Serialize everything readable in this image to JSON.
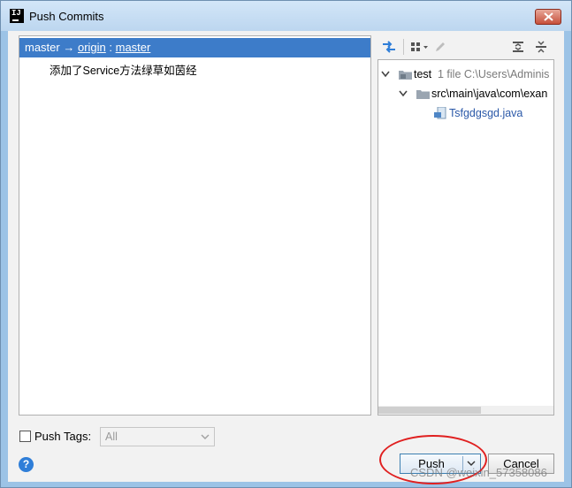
{
  "window": {
    "title": "Push Commits",
    "app_icon": "IJ"
  },
  "commits": {
    "branch_local": "master",
    "arrow": "→",
    "remote": "origin",
    "separator": " : ",
    "branch_remote": "master",
    "items": [
      "添加了Service方法绿草如茵经"
    ]
  },
  "files": {
    "toolbar_icons": [
      "compare-icon",
      "group-by-icon",
      "edit-icon",
      "expand-all-icon",
      "collapse-all-icon"
    ],
    "tree": {
      "root_label": "test",
      "root_meta": "1 file  C:\\Users\\Adminis",
      "dir_label": "src\\main\\java\\com\\exan",
      "file_label": "Tsfgdgsgd.java"
    }
  },
  "footer": {
    "push_tags_label": "Push Tags:",
    "tags_value": "All",
    "push_label": "Push",
    "cancel_label": "Cancel",
    "help": "?"
  },
  "watermark": "CSDN @weixin_57358086",
  "colors": {
    "selection": "#3d7cc9",
    "accent": "#2f7ed8",
    "annotation": "#e02020"
  }
}
